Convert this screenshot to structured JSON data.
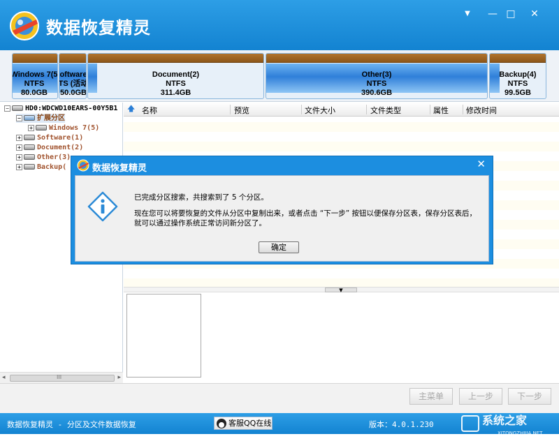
{
  "app": {
    "title": "数据恢复精灵"
  },
  "window_controls": {
    "menu": "▼",
    "minimize": "—",
    "maximize": "□",
    "close": "✕"
  },
  "partitions": [
    {
      "name": "Windows 7(5",
      "fs": "NTFS",
      "size": "80.0GB"
    },
    {
      "name": "oftware",
      "fs": "TS (活动",
      "size": "50.0GB"
    },
    {
      "name": "Document(2)",
      "fs": "NTFS",
      "size": "311.4GB"
    },
    {
      "name": "Other(3)",
      "fs": "NTFS",
      "size": "390.6GB"
    },
    {
      "name": "Backup(4)",
      "fs": "NTFS",
      "size": "99.5GB"
    }
  ],
  "tree": {
    "disk": "HD0:WDCWD10EARS-00Y5B1",
    "extended": "扩展分区",
    "items": [
      "Windows 7(5)",
      "Software(1)",
      "Document(2)",
      "Other(3)",
      "Backup("
    ]
  },
  "file_list": {
    "columns": [
      "名称",
      "预览",
      "文件大小",
      "文件类型",
      "属性",
      "修改时间"
    ]
  },
  "scrollbar": {
    "grip": "III"
  },
  "nav": {
    "main_menu": "主菜单",
    "prev": "上一步",
    "next": "下一步"
  },
  "status": {
    "left": "数据恢复精灵 - 分区及文件数据恢复",
    "qq": "客服QQ在线",
    "version": "版本：4.0.1.230"
  },
  "watermark": {
    "text": "系统之家",
    "sub": "XITONGZHIJIA.NET"
  },
  "dialog": {
    "title": "数据恢复精灵",
    "close": "✕",
    "line1": "已完成分区搜索，共搜索到了 5 个分区。",
    "line2": "现在您可以将要恢复的文件从分区中复制出来，或者点击 “下一步” 按钮以便保存分区表，保存分区表后，",
    "line3": "就可以通过操作系统正常访问新分区了。",
    "ok": "确定"
  }
}
